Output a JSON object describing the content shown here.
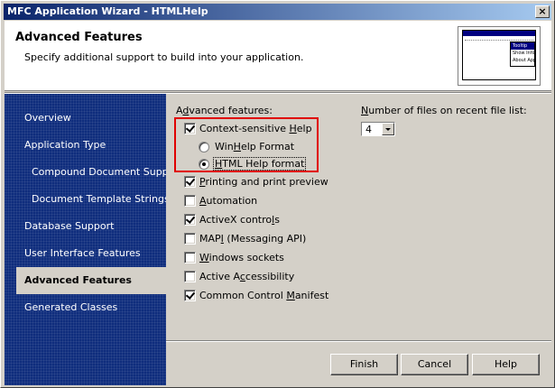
{
  "window": {
    "title": "MFC Application Wizard - HTMLHelp",
    "close_label": "×"
  },
  "header": {
    "title": "Advanced Features",
    "subtitle": "Specify additional support to build into your application.",
    "thumbnail_menu": [
      "Tooltip",
      "Show Info",
      "About App"
    ]
  },
  "sidebar": {
    "items": [
      {
        "label": "Overview"
      },
      {
        "label": "Application Type"
      },
      {
        "label": "Compound Document Support"
      },
      {
        "label": "Document Template Strings"
      },
      {
        "label": "Database Support"
      },
      {
        "label": "User Interface Features"
      },
      {
        "label": "Advanced Features",
        "active": true
      },
      {
        "label": "Generated Classes"
      }
    ]
  },
  "features": {
    "heading_pre": "A",
    "heading_u": "d",
    "heading_post": "vanced features:",
    "context_help": {
      "pre": "Context-sensitive ",
      "u": "H",
      "post": "elp",
      "checked": true
    },
    "winhelp": {
      "pre": "Win",
      "u": "H",
      "post": "elp Format",
      "checked": false
    },
    "htmlhelp": {
      "pre": "",
      "u": "H",
      "post": "TML Help format",
      "checked": true
    },
    "printing": {
      "pre": "",
      "u": "P",
      "post": "rinting and print preview",
      "checked": true
    },
    "automation": {
      "pre": "",
      "u": "A",
      "post": "utomation",
      "checked": false
    },
    "activex": {
      "pre": "ActiveX contro",
      "u": "l",
      "post": "s",
      "checked": true
    },
    "mapi": {
      "pre": "MAP",
      "u": "I",
      "post": " (Messaging API)",
      "checked": false
    },
    "sockets": {
      "pre": "",
      "u": "W",
      "post": "indows sockets",
      "checked": false
    },
    "accessibility": {
      "pre": "Active A",
      "u": "c",
      "post": "cessibility",
      "checked": false
    },
    "manifest": {
      "pre": "Common Control ",
      "u": "M",
      "post": "anifest",
      "checked": true
    }
  },
  "recent_files": {
    "label_pre": "",
    "label_u": "N",
    "label_post": "umber of files on recent file list:",
    "value": "4"
  },
  "buttons": {
    "finish": "Finish",
    "cancel": "Cancel",
    "help": "Help"
  },
  "colors": {
    "title_gradient_start": "#0a246a",
    "sidebar_bg": "#0f2d7d",
    "highlight": "#e00000"
  }
}
